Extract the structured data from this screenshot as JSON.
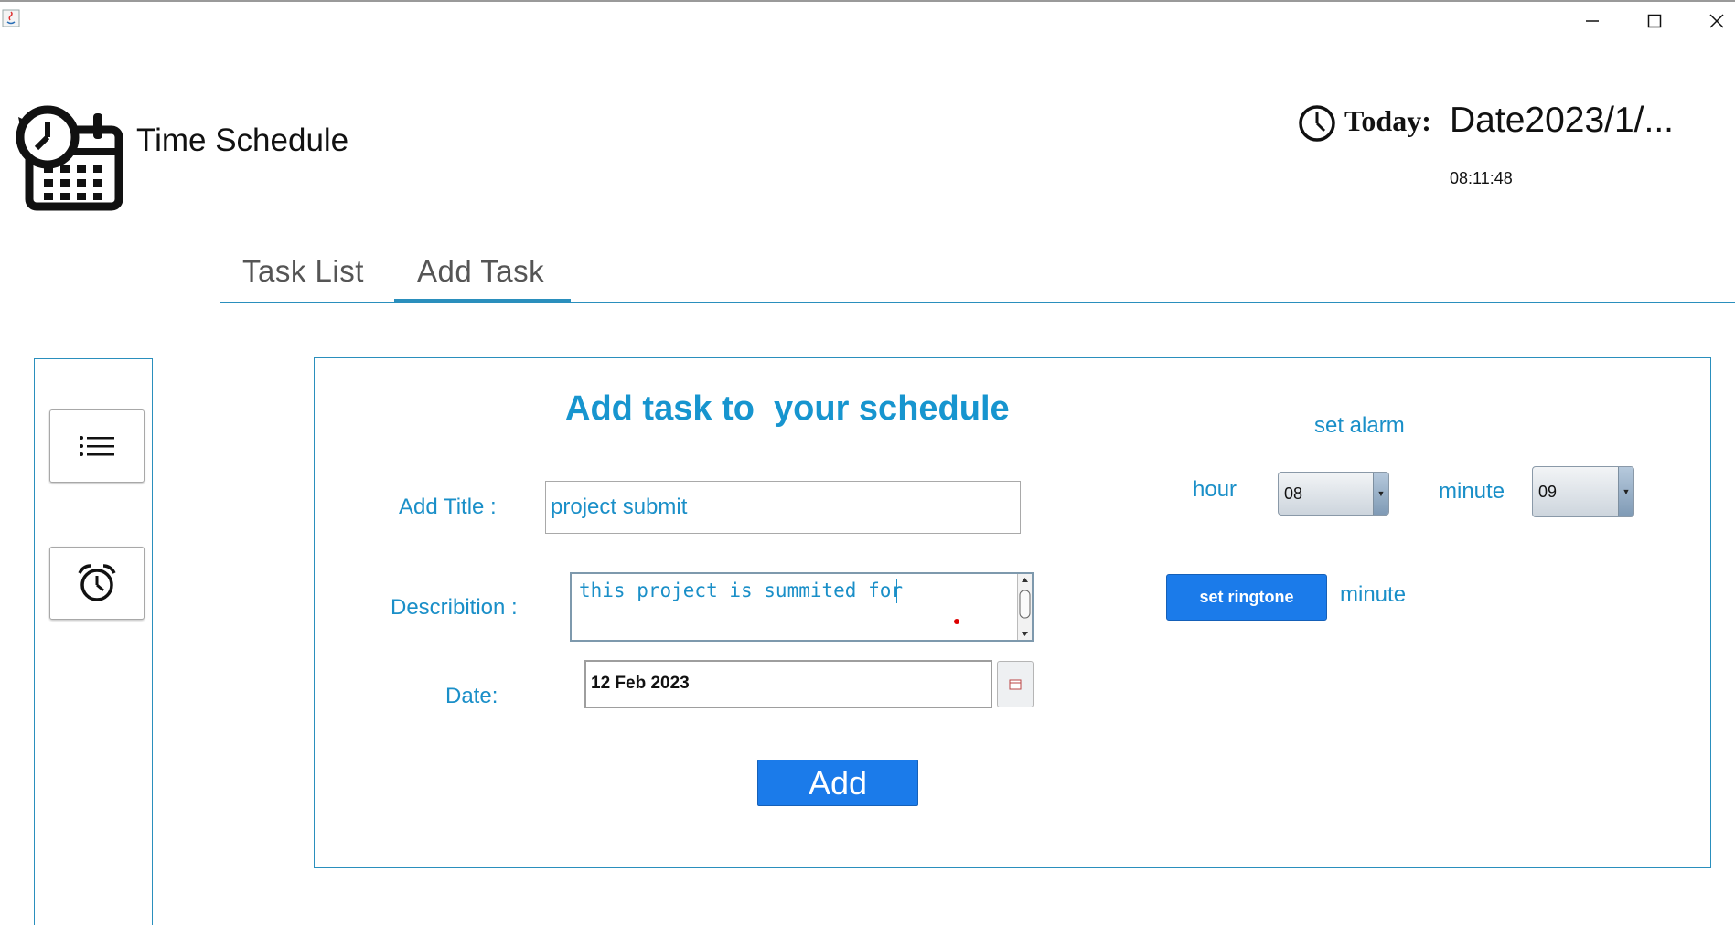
{
  "window": {
    "controls": {
      "minimize": "minimize-icon",
      "maximize": "maximize-icon",
      "close": "close-icon"
    }
  },
  "header": {
    "title": "Time Schedule",
    "today_label": "Today:",
    "date": "Date2023/1/...",
    "time": "08:11:48"
  },
  "tabs": [
    {
      "label": "Task List",
      "active": false
    },
    {
      "label": "Add Task",
      "active": true
    }
  ],
  "sidebar": {
    "items": [
      {
        "icon": "list-icon"
      },
      {
        "icon": "alarm-clock-icon"
      }
    ]
  },
  "form": {
    "heading": "Add task to  your schedule",
    "title_label": "Add Title :",
    "title_value": "project submit",
    "description_label": "Describition :",
    "description_value": "this project is summited for ",
    "date_label": "Date:",
    "date_value": "12 Feb 2023",
    "add_button": "Add"
  },
  "alarm": {
    "heading": "set alarm",
    "hour_label": "hour",
    "hour_value": "08",
    "minute_label": "minute",
    "minute_value": "09",
    "ringtone_button": "set ringtone",
    "ringtone_label": "minute"
  },
  "colors": {
    "accent": "#1a8fc8",
    "button": "#1b7bea",
    "border": "#2a8fbd"
  }
}
